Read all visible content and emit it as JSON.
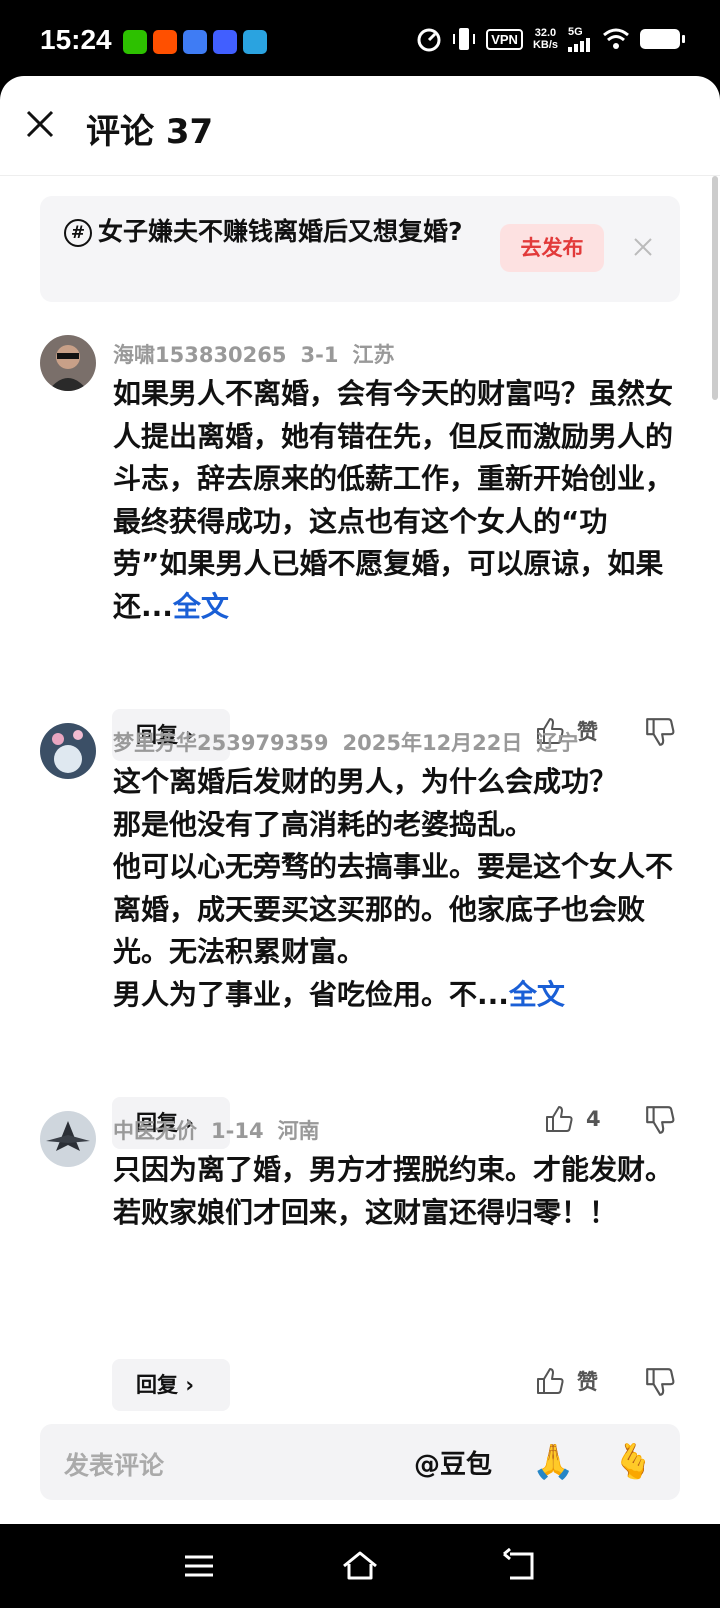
{
  "status_bar": {
    "time": "15:24",
    "vpn": "VPN",
    "speed_value": "32.0",
    "speed_unit": "KB/s",
    "network": "5G",
    "app_icons": [
      "wechat-icon",
      "taobao-icon",
      "blue-app-icon",
      "vivo-icon",
      "telegram-icon"
    ]
  },
  "header": {
    "title": "评论 37"
  },
  "topic": {
    "hash": "#",
    "text": "女子嫌夫不赚钱离婚后又想复婚?",
    "publish_label": "去发布"
  },
  "comments": [
    {
      "user": "海啸153830265",
      "date": "3-1",
      "location": "江苏",
      "text": "如果男人不离婚，会有今天的财富吗？虽然女人提出离婚，她有错在先，但反而激励男人的斗志，辞去原来的低薪工作，重新开始创业，最终获得成功，这点也有这个女人的“功劳”如果男人已婚不愿复婚，可以原谅，如果还...",
      "more_label": "全文",
      "reply_label": "回复",
      "like_label": "赞"
    },
    {
      "user": "梦里芳华253979359",
      "date": "2025年12月22日",
      "location": "辽宁",
      "text_lines": [
        "这个离婚后发财的男人，为什么会成功？",
        "那是他没有了高消耗的老婆捣乱。",
        "他可以心无旁骛的去搞事业。要是这个女人不离婚，成天要买这买那的。他家底子也会败光。无法积累财富。",
        "男人为了事业，省吃俭用。不..."
      ],
      "more_label": "全文",
      "reply_label": "回复",
      "like_label": "4"
    },
    {
      "user": "中医无价",
      "date": "1-14",
      "location": "河南",
      "text": "只因为离了婚，男方才摆脱约束。才能发财。若败家娘们才回来，这财富还得归零！！",
      "reply_label": "回复",
      "like_label": "赞"
    }
  ],
  "input_bar": {
    "placeholder": "发表评论",
    "mention": "@豆包",
    "emoji_1": "🙏",
    "emoji_2": "🫰"
  },
  "colors": {
    "link": "#1a5fd6",
    "publish_bg": "#fde1e1",
    "publish_text": "#e23a3a"
  }
}
